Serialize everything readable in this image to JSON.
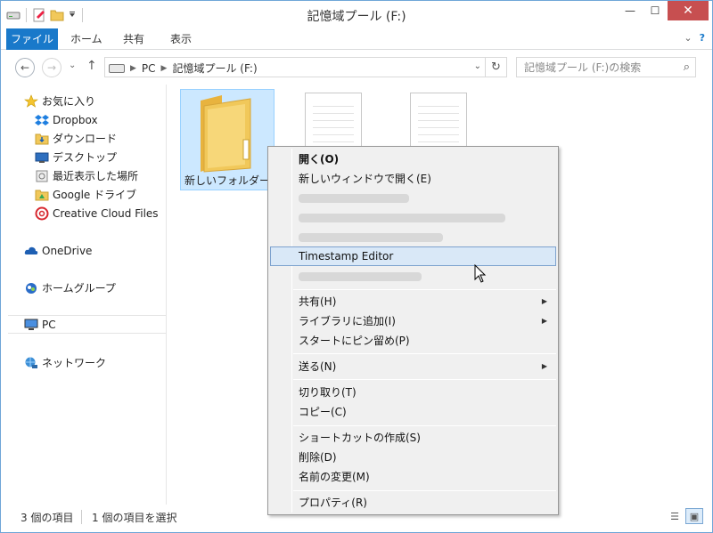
{
  "window": {
    "title": "記憶域プール (F:)",
    "minimize_glyph": "—",
    "maximize_glyph": "☐",
    "close_glyph": "✕"
  },
  "ribbon": {
    "tabs": [
      "ファイル",
      "ホーム",
      "共有",
      "表示"
    ],
    "expand_glyph": "⌄",
    "help_glyph": "?"
  },
  "address": {
    "back_glyph": "←",
    "forward_glyph": "→",
    "history_glyph": "⌄",
    "up_glyph": "↑",
    "separator": "▶",
    "crumbs": [
      "PC",
      "記憶域プール (F:)"
    ],
    "dropdown_glyph": "⌄",
    "refresh_glyph": "↻"
  },
  "search": {
    "placeholder": "記憶域プール (F:)の検索",
    "icon_glyph": "⌕"
  },
  "nav_pane": {
    "favorites": {
      "label": "お気に入り",
      "items": [
        "Dropbox",
        "ダウンロード",
        "デスクトップ",
        "最近表示した場所",
        "Google ドライブ",
        "Creative Cloud Files"
      ]
    },
    "onedrive": "OneDrive",
    "homegroup": "ホームグループ",
    "pc": "PC",
    "network": "ネットワーク"
  },
  "content": {
    "items": [
      {
        "name": "新しいフォルダー",
        "type": "folder",
        "selected": true
      },
      {
        "name": "",
        "type": "document",
        "selected": false
      },
      {
        "name": "",
        "type": "document",
        "selected": false
      }
    ]
  },
  "context_menu": {
    "items": [
      {
        "label": "開く(O)",
        "bold": true
      },
      {
        "label": "新しいウィンドウで開く(E)"
      },
      {
        "label": "Timestamp Editor",
        "hovered": true
      },
      {
        "label": "共有(H)",
        "submenu": true
      },
      {
        "label": "ライブラリに追加(I)",
        "submenu": true
      },
      {
        "label": "スタートにピン留め(P)"
      },
      {
        "label": "送る(N)",
        "submenu": true
      },
      {
        "label": "切り取り(T)"
      },
      {
        "label": "コピー(C)"
      },
      {
        "label": "ショートカットの作成(S)"
      },
      {
        "label": "削除(D)"
      },
      {
        "label": "名前の変更(M)"
      },
      {
        "label": "プロパティ(R)"
      }
    ],
    "submenu_glyph": "▶"
  },
  "status": {
    "item_count": "3 個の項目",
    "selected_count": "1 個の項目を選択",
    "details_view_glyph": "☰",
    "icons_view_glyph": "▣"
  },
  "colors": {
    "file_tab": "#1979ca",
    "close_button": "#c74f50",
    "selection": "#cce8ff",
    "menu_hover": "#d9e8f7",
    "folder": "#f1c85a"
  }
}
